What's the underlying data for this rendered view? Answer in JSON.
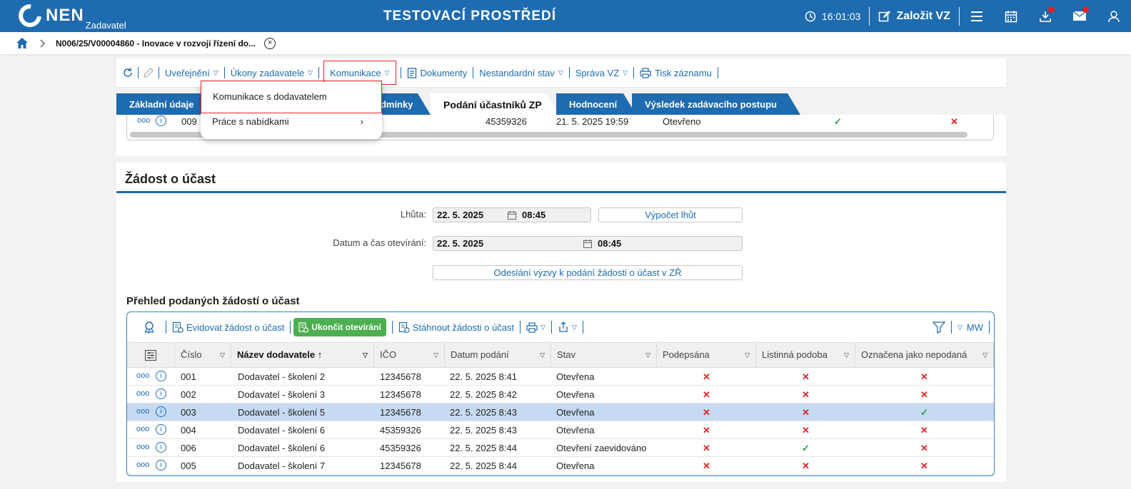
{
  "header": {
    "brand": "NEN",
    "brand_sub": "Zadavatel",
    "env_title": "TESTOVACÍ PROSTŘEDÍ",
    "time": "16:01:03",
    "create_label": "Založit VZ"
  },
  "breadcrumb": {
    "text": "N006/25/V00004860 - Inovace v rozvoji řízení do...",
    "close_glyph": "×"
  },
  "toolbar": {
    "uverejneni": "Uveřejnění",
    "ukony": "Úkony zadavatele",
    "komunikace": "Komunikace",
    "dokumenty": "Dokumenty",
    "nestandardni": "Nestandardní stav",
    "sprava": "Správa VZ",
    "tisk": "Tisk záznamu",
    "tri": "▽"
  },
  "dropdown": {
    "item1": "Komunikace s dodavatelem",
    "item2": "Práce s nabídkami",
    "arrow": "›"
  },
  "tabs": {
    "t1": "Základní údaje",
    "t2": "odmínky",
    "t3": "Podání účastníků ZP",
    "t4": "Hodnocení",
    "t5": "Výsledek zadávacího postupu"
  },
  "upper_row": {
    "dots": "ooo",
    "info": "i",
    "num": "009",
    "ico": "45359326",
    "date": "21. 5. 2025 19:59",
    "state": "Otevřeno",
    "ok": "✓",
    "x": "✕"
  },
  "section": {
    "title": "Žádost o účast",
    "lhuta_label": "Lhůta:",
    "lhuta_date": "22. 5. 2025",
    "lhuta_time": "08:45",
    "vypocet": "Výpočet lhůt",
    "otevirani_label": "Datum a čas otevírání:",
    "otevirani_date": "22. 5. 2025",
    "otevirani_time": "08:45",
    "odeslani": "Odeslání výzvy k podání žádosti o účast v ZŘ",
    "overview_title": "Přehled podaných žádostí o účast"
  },
  "grid": {
    "evidovat": "Evidovat žádost o účast",
    "ukoncit": "Ukončit otevírání",
    "stahnout": "Stáhnout žádosti o účast",
    "mw": "MW",
    "filter_tri": "▽",
    "sort_arrow": "↑",
    "columns": {
      "cislo": "Číslo",
      "nazev": "Název dodavatele",
      "ico": "IČO",
      "datum": "Datum podání",
      "stav": "Stav",
      "podepsana": "Podepsána",
      "listinna": "Listinná podoba",
      "nepodana": "Označena jako nepodaná"
    },
    "rows": [
      {
        "dots": "ooo",
        "info": "i",
        "cislo": "001",
        "nazev": "Dodavatel - školení 2",
        "ico": "12345678",
        "datum": "22. 5. 2025 8:41",
        "stav": "Otevřena",
        "podepsana": "✕",
        "listinna": "✕",
        "nepodana": "✕"
      },
      {
        "dots": "ooo",
        "info": "i",
        "cislo": "002",
        "nazev": "Dodavatel - školení 3",
        "ico": "12345678",
        "datum": "22. 5. 2025 8:42",
        "stav": "Otevřena",
        "podepsana": "✕",
        "listinna": "✕",
        "nepodana": "✕"
      },
      {
        "dots": "ooo",
        "info": "i",
        "cislo": "003",
        "nazev": "Dodavatel - školení 5",
        "ico": "12345678",
        "datum": "22. 5. 2025 8:43",
        "stav": "Otevřena",
        "podepsana": "✕",
        "listinna": "✕",
        "nepodana": "✓"
      },
      {
        "dots": "ooo",
        "info": "i",
        "cislo": "004",
        "nazev": "Dodavatel - školení 6",
        "ico": "45359326",
        "datum": "22. 5. 2025 8:43",
        "stav": "Otevřena",
        "podepsana": "✕",
        "listinna": "✕",
        "nepodana": "✕"
      },
      {
        "dots": "ooo",
        "info": "i",
        "cislo": "006",
        "nazev": "Dodavatel - školení 6",
        "ico": "45359326",
        "datum": "22. 5. 2025 8:44",
        "stav": "Otevření zaevidováno",
        "podepsana": "✕",
        "listinna": "✓",
        "nepodana": "✕"
      },
      {
        "dots": "ooo",
        "info": "i",
        "cislo": "005",
        "nazev": "Dodavatel - školení 7",
        "ico": "12345678",
        "datum": "22. 5. 2025 8:44",
        "stav": "Otevřena",
        "podepsana": "✕",
        "listinna": "✕",
        "nepodana": "✕"
      }
    ]
  },
  "colors": {
    "primary": "#1e6bb0",
    "danger": "#e02424",
    "success": "#2ea043",
    "selected_row": "#c6dbf2"
  }
}
